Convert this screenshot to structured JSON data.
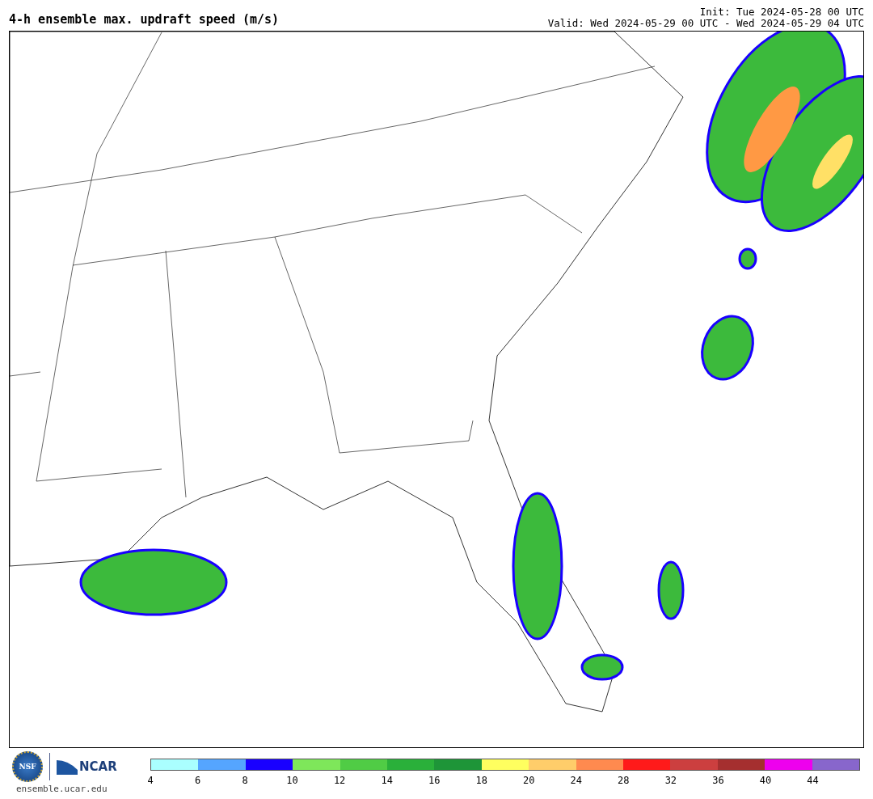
{
  "header": {
    "title": "4-h ensemble max. updraft speed (m/s)",
    "init": "Init: Tue 2024-05-28 00 UTC",
    "valid": "Valid: Wed 2024-05-29 00 UTC - Wed 2024-05-29 04 UTC"
  },
  "footer": {
    "logo_nsf": "NSF",
    "logo_ncar": "NCAR",
    "site": "ensemble.ucar.edu"
  },
  "colorbar": {
    "bins": [
      {
        "color": "#aaffff"
      },
      {
        "color": "#55a5ff"
      },
      {
        "color": "#1900ff"
      },
      {
        "color": "#7ee75a"
      },
      {
        "color": "#50cc45"
      },
      {
        "color": "#2ab03a"
      },
      {
        "color": "#1e9538"
      },
      {
        "color": "#ffff5f"
      },
      {
        "color": "#ffcd6a"
      },
      {
        "color": "#ff8a4f"
      },
      {
        "color": "#ff1a1a"
      },
      {
        "color": "#cc3f3f"
      },
      {
        "color": "#a52f2f"
      },
      {
        "color": "#ee00ee"
      },
      {
        "color": "#8866cc"
      }
    ],
    "ticks": [
      "4",
      "6",
      "8",
      "10",
      "12",
      "14",
      "16",
      "18",
      "20",
      "24",
      "28",
      "32",
      "36",
      "40",
      "44"
    ]
  }
}
